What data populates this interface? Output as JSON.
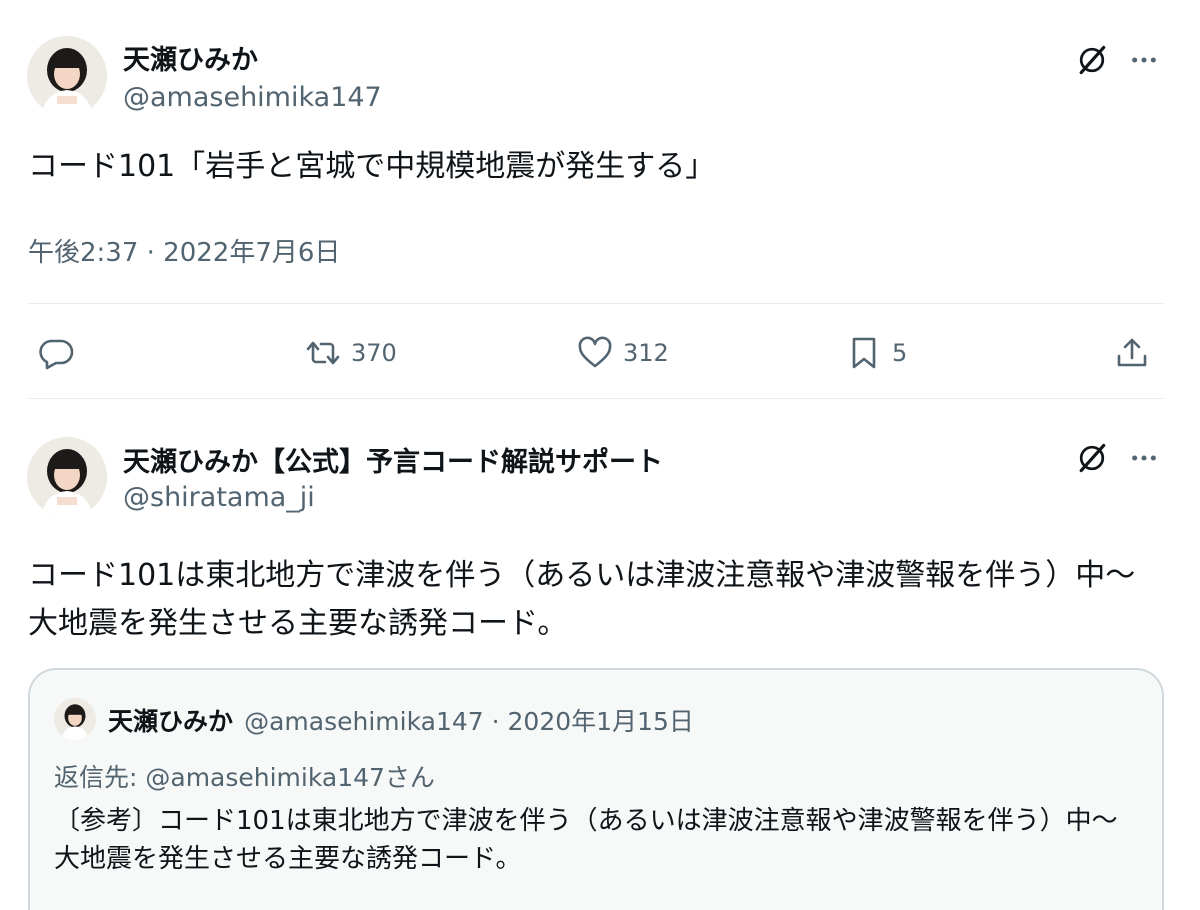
{
  "tweet1": {
    "name": "天瀬ひみか",
    "handle": "@amasehimika147",
    "text": "コード101「岩手と宮城で中規模地震が発生する」",
    "timestamp": "午後2:37 · 2022年7月6日",
    "actions": {
      "retweets": "370",
      "likes": "312",
      "bookmarks": "5"
    }
  },
  "tweet2": {
    "name": "天瀬ひみか【公式】予言コード解説サポート",
    "handle": "@shiratama_ji",
    "text": "コード101は東北地方で津波を伴う（あるいは津波注意報や津波警報を伴う）中〜大地震を発生させる主要な誘発コード。",
    "quote": {
      "name": "天瀬ひみか",
      "handle_date": "@amasehimika147 · 2020年1月15日",
      "reply_to": "返信先: @amasehimika147さん",
      "text": "〔参考〕コード101は東北地方で津波を伴う（あるいは津波注意報や津波警報を伴う）中〜大地震を発生させる主要な誘発コード。"
    }
  },
  "icons": [
    "grok-icon",
    "more-icon",
    "reply-icon",
    "retweet-icon",
    "like-icon",
    "bookmark-icon",
    "share-icon"
  ]
}
